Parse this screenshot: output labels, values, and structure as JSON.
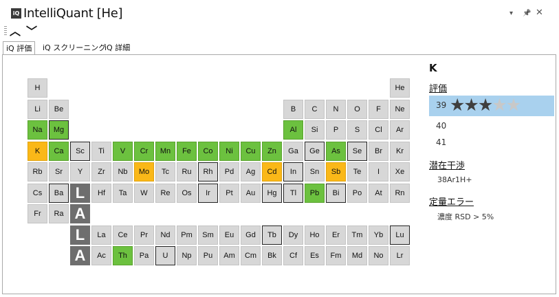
{
  "window": {
    "logo": "iQ",
    "title": "IntelliQuant [He]",
    "dropdown_glyph": "▾",
    "pin_glyph": "📌",
    "close_glyph": "✕"
  },
  "nav": {
    "up": "︿",
    "down": "﹀"
  },
  "tabs": [
    {
      "label": "iQ 評価",
      "active": true
    },
    {
      "label": "iQ スクリーニング",
      "active": false
    },
    {
      "label": "iQ 詳細",
      "active": false
    }
  ],
  "periodic_table": {
    "state_colors": {
      "green": "#6cc13f",
      "orange": "#fab818",
      "default": "#d7d7d7",
      "series_marker": "#6e6e6e"
    },
    "elements": [
      {
        "sym": "H",
        "row": 1,
        "col": 1,
        "state": "default",
        "outlined": false
      },
      {
        "sym": "He",
        "row": 1,
        "col": 18,
        "state": "default",
        "outlined": false
      },
      {
        "sym": "Li",
        "row": 2,
        "col": 1,
        "state": "default",
        "outlined": false
      },
      {
        "sym": "Be",
        "row": 2,
        "col": 2,
        "state": "default",
        "outlined": false
      },
      {
        "sym": "B",
        "row": 2,
        "col": 13,
        "state": "default",
        "outlined": false
      },
      {
        "sym": "C",
        "row": 2,
        "col": 14,
        "state": "default",
        "outlined": false
      },
      {
        "sym": "N",
        "row": 2,
        "col": 15,
        "state": "default",
        "outlined": false
      },
      {
        "sym": "O",
        "row": 2,
        "col": 16,
        "state": "default",
        "outlined": false
      },
      {
        "sym": "F",
        "row": 2,
        "col": 17,
        "state": "default",
        "outlined": false
      },
      {
        "sym": "Ne",
        "row": 2,
        "col": 18,
        "state": "default",
        "outlined": false
      },
      {
        "sym": "Na",
        "row": 3,
        "col": 1,
        "state": "green",
        "outlined": false
      },
      {
        "sym": "Mg",
        "row": 3,
        "col": 2,
        "state": "green",
        "outlined": true
      },
      {
        "sym": "Al",
        "row": 3,
        "col": 13,
        "state": "green",
        "outlined": false
      },
      {
        "sym": "Si",
        "row": 3,
        "col": 14,
        "state": "default",
        "outlined": false
      },
      {
        "sym": "P",
        "row": 3,
        "col": 15,
        "state": "default",
        "outlined": false
      },
      {
        "sym": "S",
        "row": 3,
        "col": 16,
        "state": "default",
        "outlined": false
      },
      {
        "sym": "Cl",
        "row": 3,
        "col": 17,
        "state": "default",
        "outlined": false
      },
      {
        "sym": "Ar",
        "row": 3,
        "col": 18,
        "state": "default",
        "outlined": false
      },
      {
        "sym": "K",
        "row": 4,
        "col": 1,
        "state": "orange",
        "outlined": false
      },
      {
        "sym": "Ca",
        "row": 4,
        "col": 2,
        "state": "green",
        "outlined": false
      },
      {
        "sym": "Sc",
        "row": 4,
        "col": 3,
        "state": "default",
        "outlined": true
      },
      {
        "sym": "Ti",
        "row": 4,
        "col": 4,
        "state": "default",
        "outlined": false
      },
      {
        "sym": "V",
        "row": 4,
        "col": 5,
        "state": "green",
        "outlined": false
      },
      {
        "sym": "Cr",
        "row": 4,
        "col": 6,
        "state": "green",
        "outlined": false
      },
      {
        "sym": "Mn",
        "row": 4,
        "col": 7,
        "state": "green",
        "outlined": false
      },
      {
        "sym": "Fe",
        "row": 4,
        "col": 8,
        "state": "green",
        "outlined": false
      },
      {
        "sym": "Co",
        "row": 4,
        "col": 9,
        "state": "green",
        "outlined": false
      },
      {
        "sym": "Ni",
        "row": 4,
        "col": 10,
        "state": "green",
        "outlined": false
      },
      {
        "sym": "Cu",
        "row": 4,
        "col": 11,
        "state": "green",
        "outlined": false
      },
      {
        "sym": "Zn",
        "row": 4,
        "col": 12,
        "state": "green",
        "outlined": false
      },
      {
        "sym": "Ga",
        "row": 4,
        "col": 13,
        "state": "default",
        "outlined": false
      },
      {
        "sym": "Ge",
        "row": 4,
        "col": 14,
        "state": "default",
        "outlined": true
      },
      {
        "sym": "As",
        "row": 4,
        "col": 15,
        "state": "green",
        "outlined": false
      },
      {
        "sym": "Se",
        "row": 4,
        "col": 16,
        "state": "default",
        "outlined": true
      },
      {
        "sym": "Br",
        "row": 4,
        "col": 17,
        "state": "default",
        "outlined": false
      },
      {
        "sym": "Kr",
        "row": 4,
        "col": 18,
        "state": "default",
        "outlined": false
      },
      {
        "sym": "Rb",
        "row": 5,
        "col": 1,
        "state": "default",
        "outlined": false
      },
      {
        "sym": "Sr",
        "row": 5,
        "col": 2,
        "state": "default",
        "outlined": false
      },
      {
        "sym": "Y",
        "row": 5,
        "col": 3,
        "state": "default",
        "outlined": false
      },
      {
        "sym": "Zr",
        "row": 5,
        "col": 4,
        "state": "default",
        "outlined": false
      },
      {
        "sym": "Nb",
        "row": 5,
        "col": 5,
        "state": "default",
        "outlined": false
      },
      {
        "sym": "Mo",
        "row": 5,
        "col": 6,
        "state": "orange",
        "outlined": false
      },
      {
        "sym": "Tc",
        "row": 5,
        "col": 7,
        "state": "default",
        "outlined": false
      },
      {
        "sym": "Ru",
        "row": 5,
        "col": 8,
        "state": "default",
        "outlined": false
      },
      {
        "sym": "Rh",
        "row": 5,
        "col": 9,
        "state": "default",
        "outlined": true
      },
      {
        "sym": "Pd",
        "row": 5,
        "col": 10,
        "state": "default",
        "outlined": false
      },
      {
        "sym": "Ag",
        "row": 5,
        "col": 11,
        "state": "default",
        "outlined": false
      },
      {
        "sym": "Cd",
        "row": 5,
        "col": 12,
        "state": "orange",
        "outlined": false
      },
      {
        "sym": "In",
        "row": 5,
        "col": 13,
        "state": "default",
        "outlined": true
      },
      {
        "sym": "Sn",
        "row": 5,
        "col": 14,
        "state": "default",
        "outlined": false
      },
      {
        "sym": "Sb",
        "row": 5,
        "col": 15,
        "state": "orange",
        "outlined": false
      },
      {
        "sym": "Te",
        "row": 5,
        "col": 16,
        "state": "default",
        "outlined": false
      },
      {
        "sym": "I",
        "row": 5,
        "col": 17,
        "state": "default",
        "outlined": false
      },
      {
        "sym": "Xe",
        "row": 5,
        "col": 18,
        "state": "default",
        "outlined": false
      },
      {
        "sym": "Cs",
        "row": 6,
        "col": 1,
        "state": "default",
        "outlined": false
      },
      {
        "sym": "Ba",
        "row": 6,
        "col": 2,
        "state": "default",
        "outlined": true
      },
      {
        "sym": "Hf",
        "row": 6,
        "col": 4,
        "state": "default",
        "outlined": false
      },
      {
        "sym": "Ta",
        "row": 6,
        "col": 5,
        "state": "default",
        "outlined": false
      },
      {
        "sym": "W",
        "row": 6,
        "col": 6,
        "state": "default",
        "outlined": false
      },
      {
        "sym": "Re",
        "row": 6,
        "col": 7,
        "state": "default",
        "outlined": false
      },
      {
        "sym": "Os",
        "row": 6,
        "col": 8,
        "state": "default",
        "outlined": false
      },
      {
        "sym": "Ir",
        "row": 6,
        "col": 9,
        "state": "default",
        "outlined": true
      },
      {
        "sym": "Pt",
        "row": 6,
        "col": 10,
        "state": "default",
        "outlined": false
      },
      {
        "sym": "Au",
        "row": 6,
        "col": 11,
        "state": "default",
        "outlined": false
      },
      {
        "sym": "Hg",
        "row": 6,
        "col": 12,
        "state": "default",
        "outlined": true
      },
      {
        "sym": "Tl",
        "row": 6,
        "col": 13,
        "state": "default",
        "outlined": true
      },
      {
        "sym": "Pb",
        "row": 6,
        "col": 14,
        "state": "green",
        "outlined": false
      },
      {
        "sym": "Bi",
        "row": 6,
        "col": 15,
        "state": "default",
        "outlined": true
      },
      {
        "sym": "Po",
        "row": 6,
        "col": 16,
        "state": "default",
        "outlined": false
      },
      {
        "sym": "At",
        "row": 6,
        "col": 17,
        "state": "default",
        "outlined": false
      },
      {
        "sym": "Rn",
        "row": 6,
        "col": 18,
        "state": "default",
        "outlined": false
      },
      {
        "sym": "Fr",
        "row": 7,
        "col": 1,
        "state": "default",
        "outlined": false
      },
      {
        "sym": "Ra",
        "row": 7,
        "col": 2,
        "state": "default",
        "outlined": false
      },
      {
        "sym": "La",
        "row": 8,
        "col": 4,
        "state": "default",
        "outlined": false
      },
      {
        "sym": "Ce",
        "row": 8,
        "col": 5,
        "state": "default",
        "outlined": false
      },
      {
        "sym": "Pr",
        "row": 8,
        "col": 6,
        "state": "default",
        "outlined": false
      },
      {
        "sym": "Nd",
        "row": 8,
        "col": 7,
        "state": "default",
        "outlined": false
      },
      {
        "sym": "Pm",
        "row": 8,
        "col": 8,
        "state": "default",
        "outlined": false
      },
      {
        "sym": "Sm",
        "row": 8,
        "col": 9,
        "state": "default",
        "outlined": false
      },
      {
        "sym": "Eu",
        "row": 8,
        "col": 10,
        "state": "default",
        "outlined": false
      },
      {
        "sym": "Gd",
        "row": 8,
        "col": 11,
        "state": "default",
        "outlined": false
      },
      {
        "sym": "Tb",
        "row": 8,
        "col": 12,
        "state": "default",
        "outlined": true
      },
      {
        "sym": "Dy",
        "row": 8,
        "col": 13,
        "state": "default",
        "outlined": false
      },
      {
        "sym": "Ho",
        "row": 8,
        "col": 14,
        "state": "default",
        "outlined": false
      },
      {
        "sym": "Er",
        "row": 8,
        "col": 15,
        "state": "default",
        "outlined": false
      },
      {
        "sym": "Tm",
        "row": 8,
        "col": 16,
        "state": "default",
        "outlined": false
      },
      {
        "sym": "Yb",
        "row": 8,
        "col": 17,
        "state": "default",
        "outlined": false
      },
      {
        "sym": "Lu",
        "row": 8,
        "col": 18,
        "state": "default",
        "outlined": true
      },
      {
        "sym": "Ac",
        "row": 9,
        "col": 4,
        "state": "default",
        "outlined": false
      },
      {
        "sym": "Th",
        "row": 9,
        "col": 5,
        "state": "green",
        "outlined": false
      },
      {
        "sym": "Pa",
        "row": 9,
        "col": 6,
        "state": "default",
        "outlined": false
      },
      {
        "sym": "U",
        "row": 9,
        "col": 7,
        "state": "default",
        "outlined": true
      },
      {
        "sym": "Np",
        "row": 9,
        "col": 8,
        "state": "default",
        "outlined": false
      },
      {
        "sym": "Pu",
        "row": 9,
        "col": 9,
        "state": "default",
        "outlined": false
      },
      {
        "sym": "Am",
        "row": 9,
        "col": 10,
        "state": "default",
        "outlined": false
      },
      {
        "sym": "Cm",
        "row": 9,
        "col": 11,
        "state": "default",
        "outlined": false
      },
      {
        "sym": "Bk",
        "row": 9,
        "col": 12,
        "state": "default",
        "outlined": false
      },
      {
        "sym": "Cf",
        "row": 9,
        "col": 13,
        "state": "default",
        "outlined": false
      },
      {
        "sym": "Es",
        "row": 9,
        "col": 14,
        "state": "default",
        "outlined": false
      },
      {
        "sym": "Fm",
        "row": 9,
        "col": 15,
        "state": "default",
        "outlined": false
      },
      {
        "sym": "Md",
        "row": 9,
        "col": 16,
        "state": "default",
        "outlined": false
      },
      {
        "sym": "No",
        "row": 9,
        "col": 17,
        "state": "default",
        "outlined": false
      },
      {
        "sym": "Lr",
        "row": 9,
        "col": 18,
        "state": "default",
        "outlined": false
      }
    ],
    "series_markers": [
      {
        "label": "L",
        "row": 6,
        "col": 3
      },
      {
        "label": "A",
        "row": 7,
        "col": 3
      },
      {
        "label": "L",
        "row": 8,
        "col": 3
      },
      {
        "label": "A",
        "row": 9,
        "col": 3
      }
    ]
  },
  "details": {
    "symbol": "K",
    "rating_heading": "評価",
    "ratings": [
      {
        "mass": "39",
        "stars": 3,
        "max": 5,
        "selected": true
      },
      {
        "mass": "40",
        "stars": 0,
        "max": 0,
        "selected": false
      },
      {
        "mass": "41",
        "stars": 0,
        "max": 0,
        "selected": false
      }
    ],
    "interference_heading": "潜在干渉",
    "interference_items": [
      "38Ar1H+"
    ],
    "quant_heading": "定量エラー",
    "quant_items": [
      "濃度 RSD > 5%"
    ]
  }
}
